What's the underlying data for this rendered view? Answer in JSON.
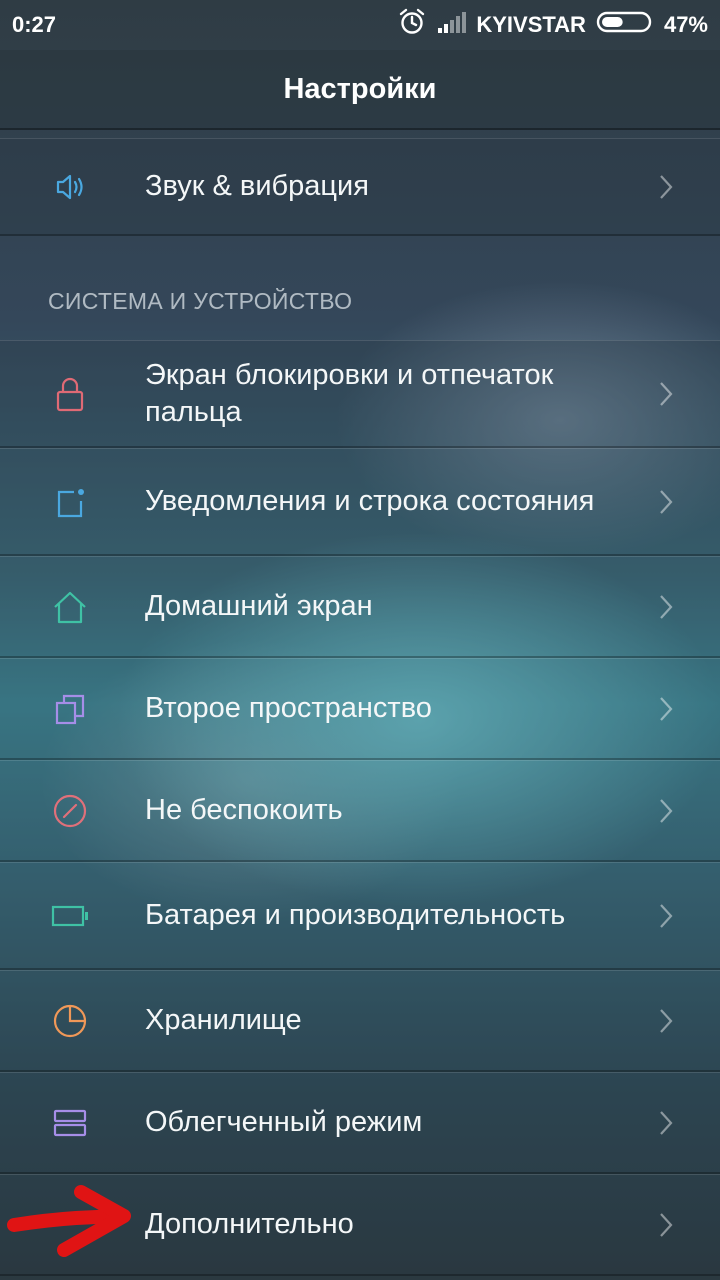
{
  "status": {
    "time": "0:27",
    "carrier": "KYIVSTAR",
    "battery": "47%",
    "battery_level": 0.47
  },
  "header": {
    "title": "Настройки"
  },
  "settings": {
    "sound": "Звук & вибрация",
    "section_title": "СИСТЕМА И УСТРОЙСТВО",
    "items": [
      {
        "label": "Экран блокировки и отпечаток пальца",
        "icon": "lock-icon",
        "color": "#e06a75"
      },
      {
        "label": "Уведомления и строка состояния",
        "icon": "notification-icon",
        "color": "#4aa8e0"
      },
      {
        "label": "Домашний экран",
        "icon": "home-icon",
        "color": "#3fc2a5"
      },
      {
        "label": "Второе пространство",
        "icon": "second-space-icon",
        "color": "#a68ee8"
      },
      {
        "label": "Не беспокоить",
        "icon": "do-not-disturb-icon",
        "color": "#e0707a"
      },
      {
        "label": "Батарея и производительность",
        "icon": "battery-icon",
        "color": "#3fc2a5"
      },
      {
        "label": "Хранилище",
        "icon": "storage-icon",
        "color": "#f09858"
      },
      {
        "label": "Облегченный режим",
        "icon": "lite-mode-icon",
        "color": "#a68ee8"
      },
      {
        "label": "Дополнительно",
        "icon": "more-icon",
        "color": "#ffffff"
      }
    ],
    "sound_icon_color": "#4aa8e0",
    "arrow_color": "#e01414"
  }
}
